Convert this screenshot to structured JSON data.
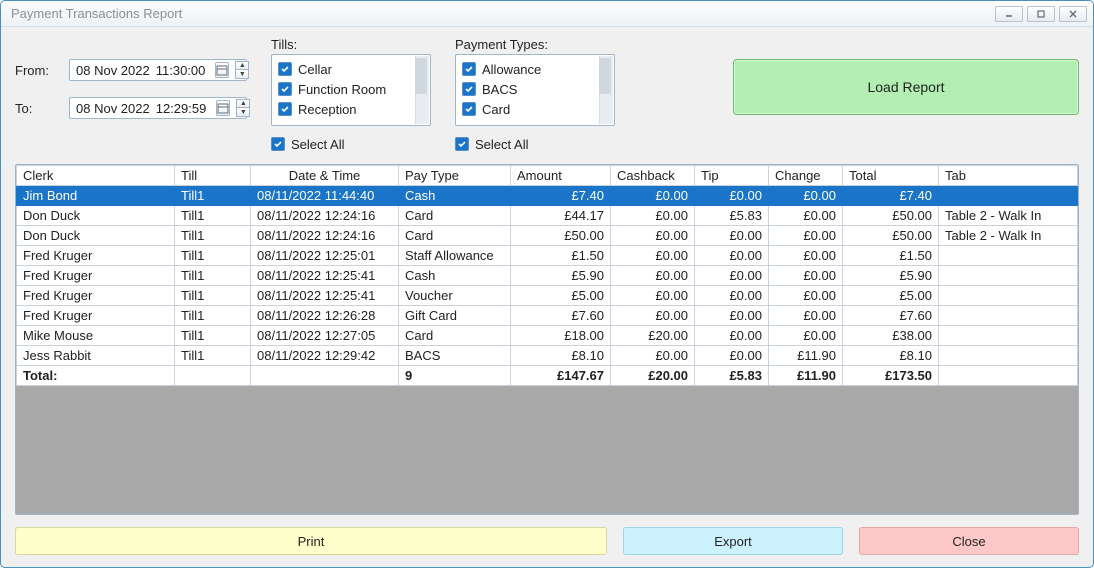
{
  "window": {
    "title": "Payment Transactions Report"
  },
  "dates": {
    "from_label": "From:",
    "to_label": "To:",
    "from_date": "08 Nov 2022",
    "from_time": "11:30:00",
    "to_date": "08 Nov 2022",
    "to_time": "12:29:59"
  },
  "tills": {
    "label": "Tills:",
    "items": [
      "Cellar",
      "Function Room",
      "Reception"
    ],
    "select_all_label": "Select All"
  },
  "payment_types": {
    "label": "Payment Types:",
    "items": [
      "Allowance",
      "BACS",
      "Card"
    ],
    "select_all_label": "Select All"
  },
  "load_button_label": "Load Report",
  "grid": {
    "headers": {
      "clerk": "Clerk",
      "till": "Till",
      "datetime": "Date & Time",
      "pay_type": "Pay Type",
      "amount": "Amount",
      "cashback": "Cashback",
      "tip": "Tip",
      "change": "Change",
      "total": "Total",
      "tab": "Tab"
    },
    "rows": [
      {
        "clerk": "Jim Bond",
        "till": "Till1",
        "datetime": "08/11/2022 11:44:40",
        "pay_type": "Cash",
        "amount": "£7.40",
        "cashback": "£0.00",
        "tip": "£0.00",
        "change": "£0.00",
        "total": "£7.40",
        "tab": "",
        "selected": true
      },
      {
        "clerk": "Don Duck",
        "till": "Till1",
        "datetime": "08/11/2022 12:24:16",
        "pay_type": "Card",
        "amount": "£44.17",
        "cashback": "£0.00",
        "tip": "£5.83",
        "change": "£0.00",
        "total": "£50.00",
        "tab": "Table 2 - Walk In"
      },
      {
        "clerk": "Don Duck",
        "till": "Till1",
        "datetime": "08/11/2022 12:24:16",
        "pay_type": "Card",
        "amount": "£50.00",
        "cashback": "£0.00",
        "tip": "£0.00",
        "change": "£0.00",
        "total": "£50.00",
        "tab": "Table 2 - Walk In"
      },
      {
        "clerk": "Fred Kruger",
        "till": "Till1",
        "datetime": "08/11/2022 12:25:01",
        "pay_type": "Staff Allowance",
        "amount": "£1.50",
        "cashback": "£0.00",
        "tip": "£0.00",
        "change": "£0.00",
        "total": "£1.50",
        "tab": ""
      },
      {
        "clerk": "Fred Kruger",
        "till": "Till1",
        "datetime": "08/11/2022 12:25:41",
        "pay_type": "Cash",
        "amount": "£5.90",
        "cashback": "£0.00",
        "tip": "£0.00",
        "change": "£0.00",
        "total": "£5.90",
        "tab": ""
      },
      {
        "clerk": "Fred Kruger",
        "till": "Till1",
        "datetime": "08/11/2022 12:25:41",
        "pay_type": "Voucher",
        "amount": "£5.00",
        "cashback": "£0.00",
        "tip": "£0.00",
        "change": "£0.00",
        "total": "£5.00",
        "tab": ""
      },
      {
        "clerk": "Fred Kruger",
        "till": "Till1",
        "datetime": "08/11/2022 12:26:28",
        "pay_type": "Gift Card",
        "amount": "£7.60",
        "cashback": "£0.00",
        "tip": "£0.00",
        "change": "£0.00",
        "total": "£7.60",
        "tab": ""
      },
      {
        "clerk": "Mike Mouse",
        "till": "Till1",
        "datetime": "08/11/2022 12:27:05",
        "pay_type": "Card",
        "amount": "£18.00",
        "cashback": "£20.00",
        "tip": "£0.00",
        "change": "£0.00",
        "total": "£38.00",
        "tab": ""
      },
      {
        "clerk": "Jess Rabbit",
        "till": "Till1",
        "datetime": "08/11/2022 12:29:42",
        "pay_type": "BACS",
        "amount": "£8.10",
        "cashback": "£0.00",
        "tip": "£0.00",
        "change": "£11.90",
        "total": "£8.10",
        "tab": ""
      }
    ],
    "totals": {
      "clerk": "Total:",
      "till": "",
      "datetime": "",
      "pay_type": "9",
      "amount": "£147.67",
      "cashback": "£20.00",
      "tip": "£5.83",
      "change": "£11.90",
      "total": "£173.50",
      "tab": ""
    }
  },
  "footer": {
    "print": "Print",
    "export": "Export",
    "close": "Close"
  }
}
